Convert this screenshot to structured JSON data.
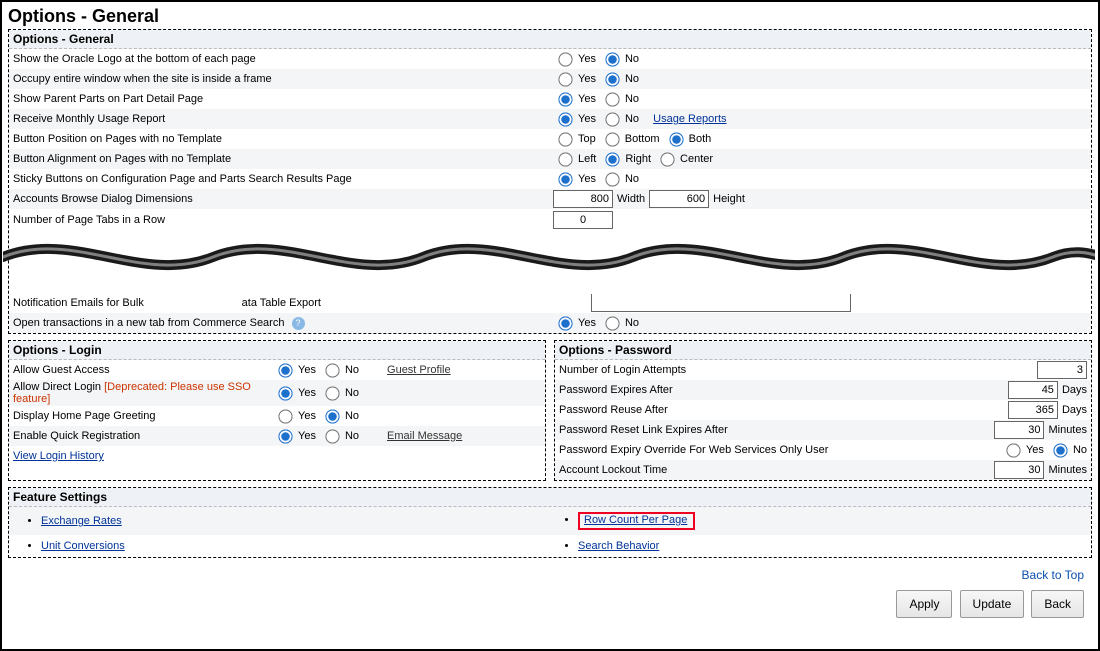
{
  "pageTitle": "Options - General",
  "panels": {
    "general": {
      "title": "Options - General",
      "rows": {
        "r0": {
          "label": "Show the Oracle Logo at the bottom of each page",
          "opt1": "Yes",
          "opt2": "No"
        },
        "r1": {
          "label": "Occupy entire window when the site is inside a frame",
          "opt1": "Yes",
          "opt2": "No"
        },
        "r2": {
          "label": "Show Parent Parts on Part Detail Page",
          "opt1": "Yes",
          "opt2": "No"
        },
        "r3": {
          "label": "Receive Monthly Usage Report",
          "opt1": "Yes",
          "opt2": "No",
          "link": "Usage Reports"
        },
        "r4": {
          "label": "Button Position on Pages with no Template",
          "opt1": "Top",
          "opt2": "Bottom",
          "opt3": "Both"
        },
        "r5": {
          "label": "Button Alignment on Pages with no Template",
          "opt1": "Left",
          "opt2": "Right",
          "opt3": "Center"
        },
        "r6": {
          "label": "Sticky Buttons on Configuration Page and Parts Search Results Page",
          "opt1": "Yes",
          "opt2": "No"
        },
        "r7": {
          "label": "Accounts Browse Dialog Dimensions",
          "v1": "800",
          "u1": "Width",
          "v2": "600",
          "u2": "Height"
        },
        "r8": {
          "label": "Number of Page Tabs in a Row",
          "v1": "0"
        },
        "r9a": {
          "labelA": "Notification Emails for Bulk ",
          "labelB": "ata Table Export"
        },
        "r9b": {
          "label": "Open transactions in a new tab from Commerce Search",
          "opt1": "Yes",
          "opt2": "No"
        }
      }
    },
    "login": {
      "title": "Options - Login",
      "rows": {
        "l0": {
          "label": "Allow Guest Access",
          "opt1": "Yes",
          "opt2": "No",
          "extra": "Guest Profile"
        },
        "l1": {
          "label": "Allow Direct Login",
          "dep": "[Deprecated: Please use SSO feature]",
          "opt1": "Yes",
          "opt2": "No"
        },
        "l2": {
          "label": "Display Home Page Greeting",
          "opt1": "Yes",
          "opt2": "No"
        },
        "l3": {
          "label": "Enable Quick Registration",
          "opt1": "Yes",
          "opt2": "No",
          "extra": "Email Message"
        },
        "link": "View Login History"
      }
    },
    "password": {
      "title": "Options - Password",
      "rows": {
        "p0": {
          "label": "Number of Login Attempts",
          "val": "3"
        },
        "p1": {
          "label": "Password Expires After",
          "val": "45",
          "unit": "Days"
        },
        "p2": {
          "label": "Password Reuse After",
          "val": "365",
          "unit": "Days"
        },
        "p3": {
          "label": "Password Reset Link Expires After",
          "val": "30",
          "unit": "Minutes"
        },
        "p4": {
          "label": "Password Expiry Override For Web Services Only User",
          "opt1": "Yes",
          "opt2": "No"
        },
        "p5": {
          "label": "Account Lockout Time",
          "val": "30",
          "unit": "Minutes"
        }
      }
    },
    "features": {
      "title": "Feature Settings",
      "left": {
        "f0": "Exchange Rates",
        "f1": "Unit Conversions"
      },
      "right": {
        "f0": "Row Count Per Page",
        "f1": "Search Behavior"
      }
    }
  },
  "backTop": "Back to Top",
  "buttons": {
    "apply": "Apply",
    "update": "Update",
    "back": "Back"
  }
}
